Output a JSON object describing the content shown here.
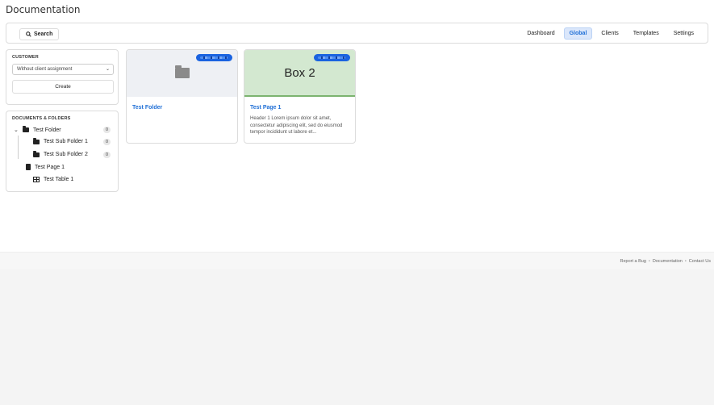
{
  "page": {
    "title": "Documentation"
  },
  "toolbar": {
    "search_label": "Search",
    "nav": [
      {
        "label": "Dashboard",
        "active": false
      },
      {
        "label": "Global",
        "active": true
      },
      {
        "label": "Clients",
        "active": false
      },
      {
        "label": "Templates",
        "active": false
      },
      {
        "label": "Settings",
        "active": false
      }
    ]
  },
  "customer": {
    "section_label": "CUSTOMER",
    "select_value": "Without client assignment",
    "create_label": "Create"
  },
  "documents": {
    "section_label": "DOCUMENTS & FOLDERS",
    "tree": [
      {
        "label": "Test Folder",
        "type": "folder",
        "badge": "0"
      },
      {
        "label": "Test Sub Folder 1",
        "type": "folder",
        "badge": "0"
      },
      {
        "label": "Test Sub Folder 2",
        "type": "folder",
        "badge": "0"
      },
      {
        "label": "Test Page 1",
        "type": "page"
      },
      {
        "label": "Test Table 1",
        "type": "table"
      }
    ]
  },
  "cards": [
    {
      "title": "Test Folder",
      "type": "folder"
    },
    {
      "title": "Test Page 1",
      "type": "page",
      "thumb_text": "Box 2",
      "description": "Header 1 Lorem ipsum dolor sit amet, consectetur adipiscing elit, sed do eiusmod tempor incididunt ut labore et..."
    }
  ],
  "footer": {
    "links": [
      "Report a Bug",
      "Documentation",
      "Contact Us"
    ],
    "separator": "•"
  },
  "colors": {
    "accent": "#1f6fd6",
    "badge_blue": "#1a63e0",
    "page_thumb": "#d3e8d0"
  }
}
